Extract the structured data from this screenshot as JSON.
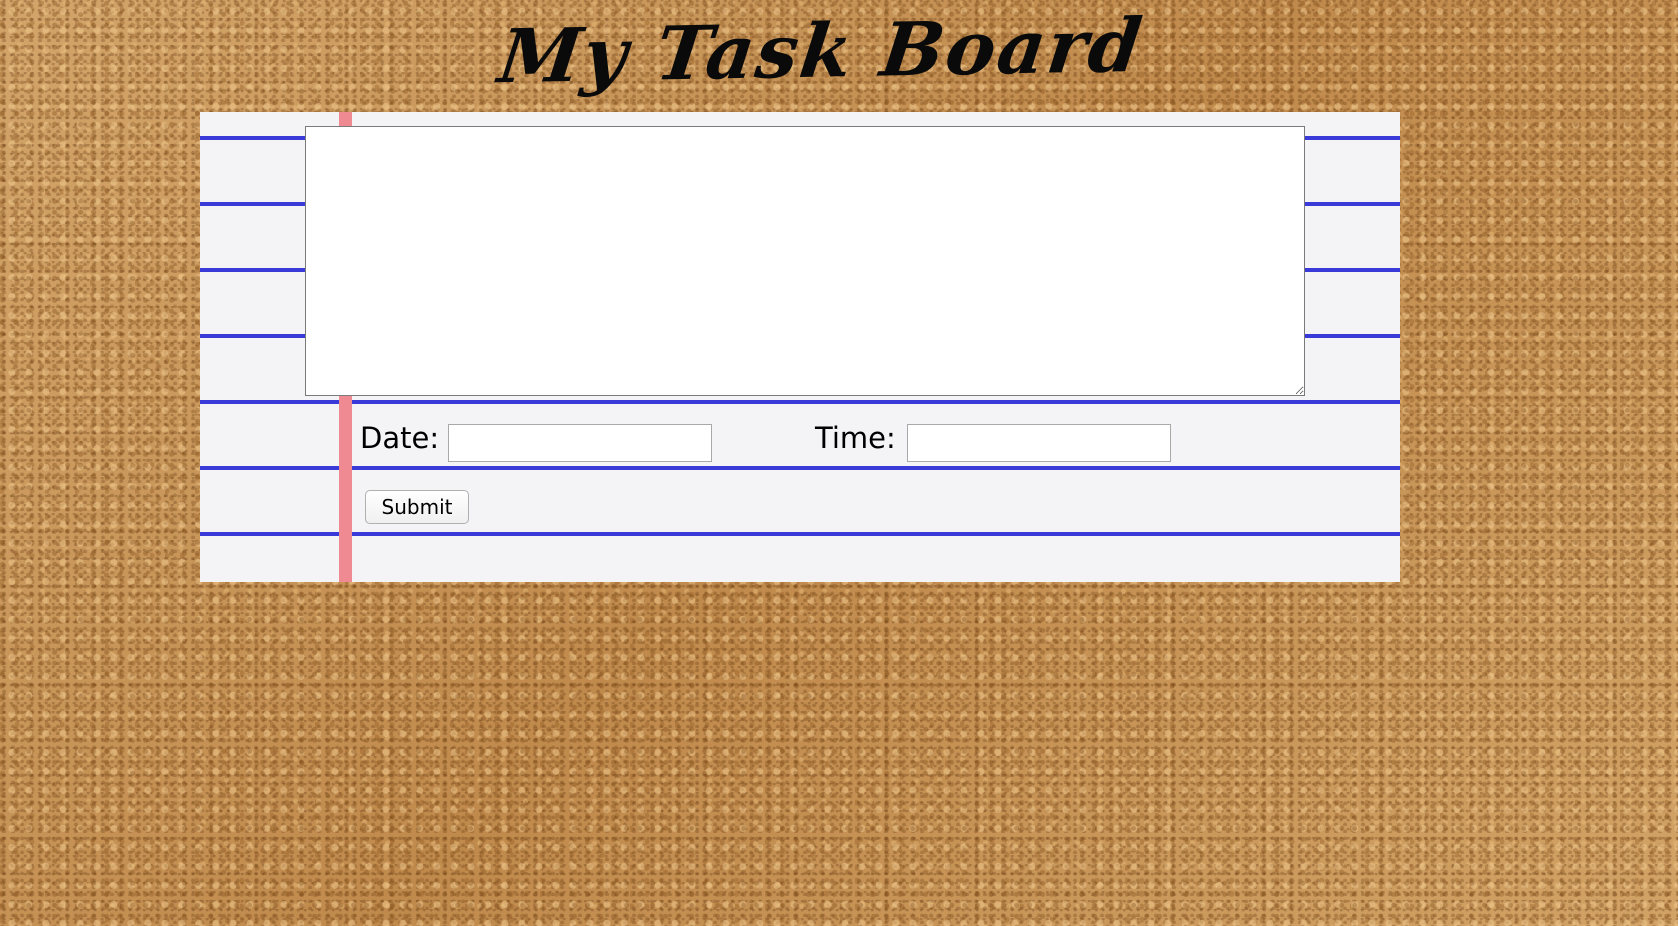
{
  "header": {
    "title": "My Task Board"
  },
  "form": {
    "task_text": "",
    "date_label": "Date:",
    "date_value": "",
    "time_label": "Time:",
    "time_value": "",
    "submit_label": "Submit"
  },
  "colors": {
    "paper": "#f4f4f6",
    "rule_line": "#3a3ad8",
    "margin_line": "#f08a92",
    "cork": "#c99a5a"
  }
}
